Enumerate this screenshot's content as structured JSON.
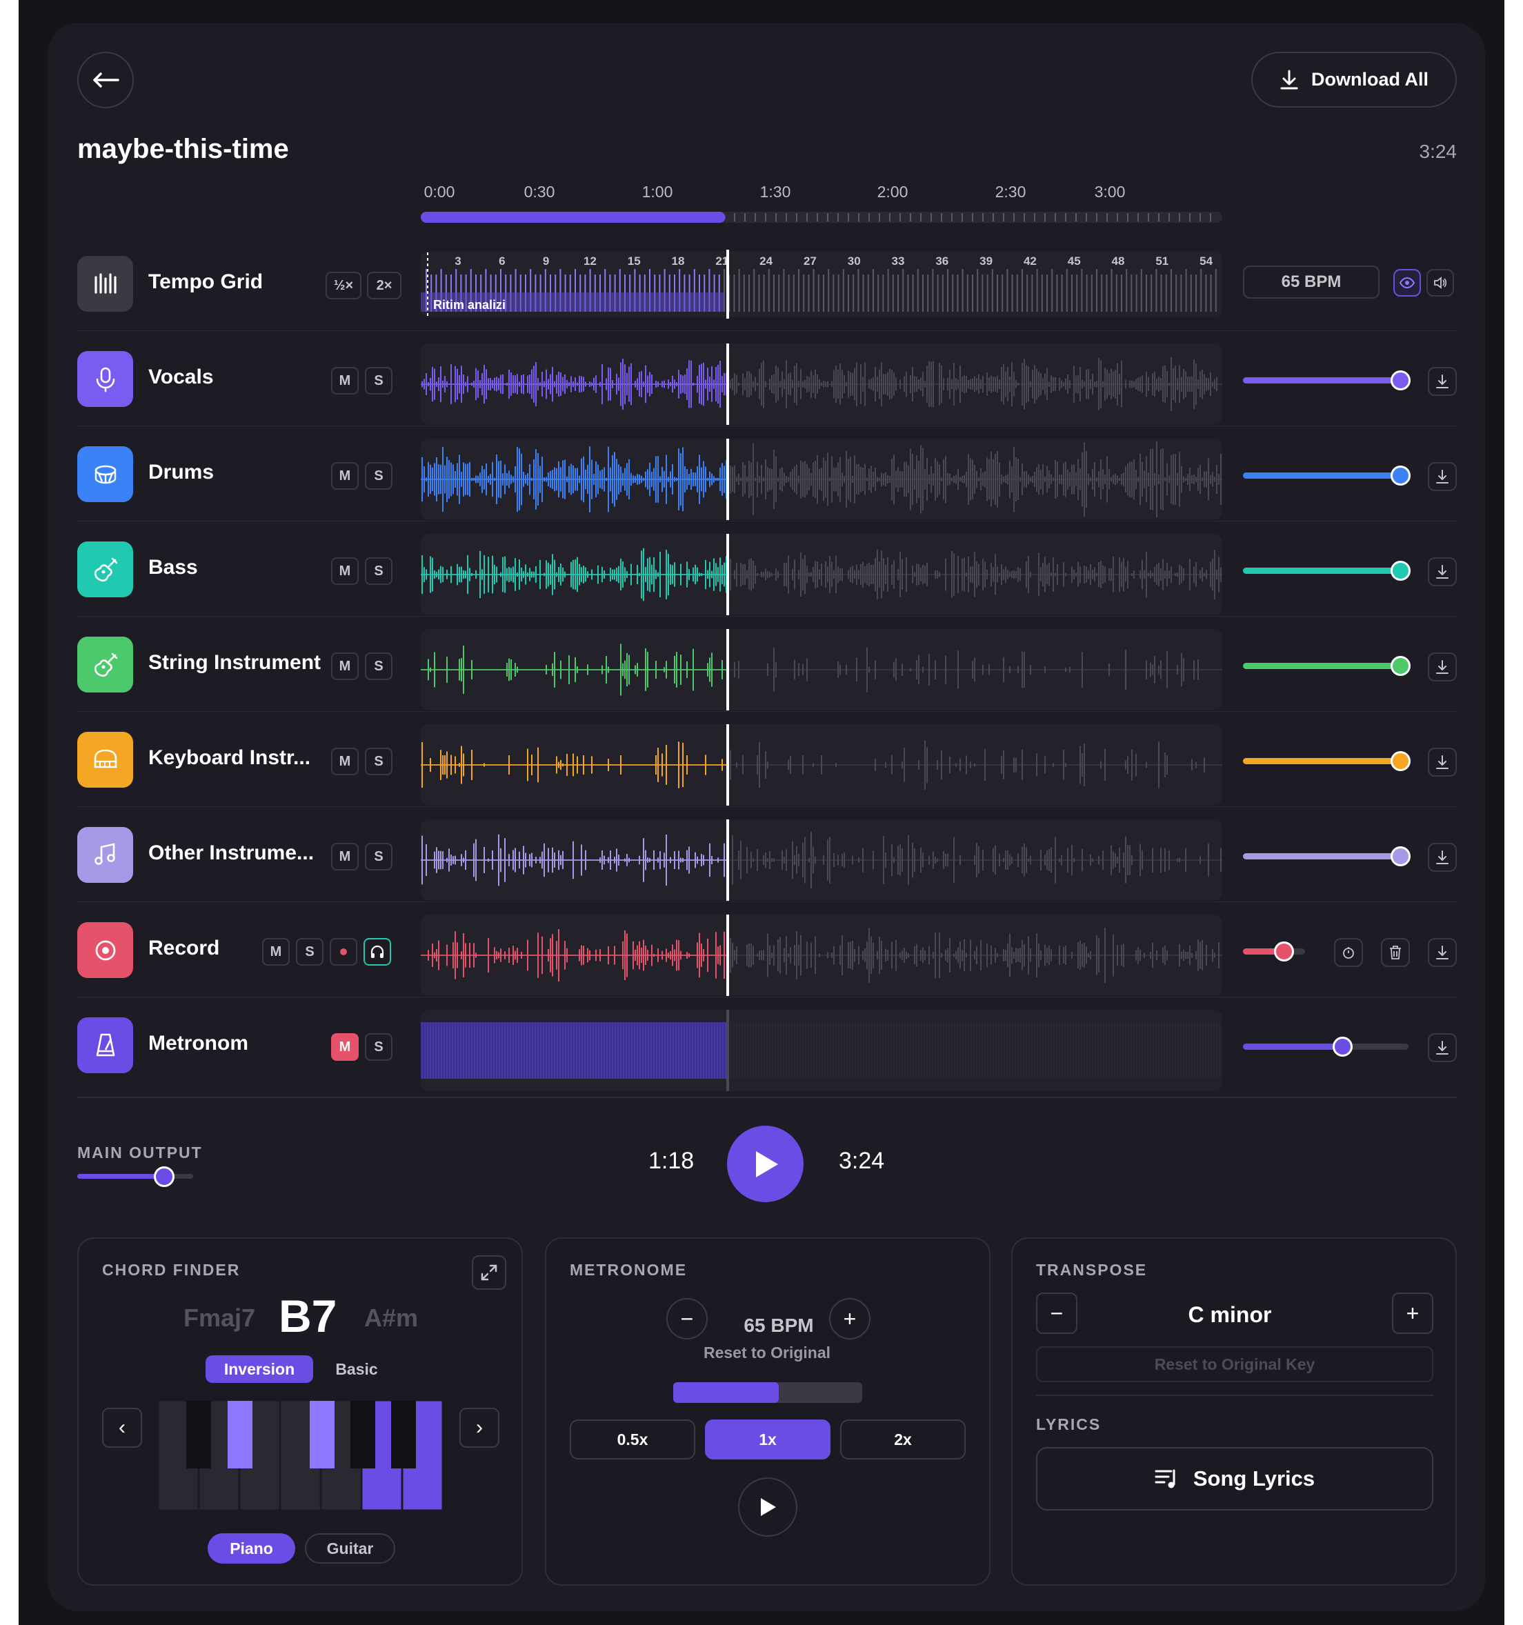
{
  "song": {
    "title": "maybe-this-time",
    "duration": "3:24"
  },
  "header": {
    "download_all": "Download All"
  },
  "timeline": {
    "ticks": [
      "0:00",
      "0:30",
      "1:00",
      "1:30",
      "2:00",
      "2:30",
      "3:00"
    ],
    "progress_fraction": 0.38
  },
  "tempo": {
    "name": "Tempo Grid",
    "half": "½×",
    "double": "2×",
    "bpm_badge": "65 BPM",
    "analysis_label": "Ritim analizi",
    "beats": [
      "3",
      "6",
      "9",
      "12",
      "15",
      "18",
      "21",
      "24",
      "27",
      "30",
      "33",
      "36",
      "39",
      "42",
      "45",
      "48",
      "51",
      "54"
    ]
  },
  "tracks": [
    {
      "name": "Vocals",
      "color": "#7b5cf0",
      "icon": "microphone-icon",
      "volume": 0.95
    },
    {
      "name": "Drums",
      "color": "#3b82f6",
      "icon": "drum-icon",
      "volume": 0.95
    },
    {
      "name": "Bass",
      "color": "#20c9b0",
      "icon": "guitar-icon",
      "volume": 0.95
    },
    {
      "name": "String Instrument",
      "color": "#4cc96a",
      "icon": "guitar-icon",
      "volume": 0.95
    },
    {
      "name": "Keyboard Instr...",
      "color": "#f5a623",
      "icon": "piano-icon",
      "volume": 0.95
    },
    {
      "name": "Other Instrume...",
      "color": "#a59ae6",
      "icon": "music-note-icon",
      "volume": 0.95
    },
    {
      "name": "Record",
      "color": "#e5526a",
      "icon": "record-icon",
      "volume": 0.65
    },
    {
      "name": "Metronom",
      "color": "#6b4de6",
      "icon": "metronome-icon",
      "volume": 0.6
    }
  ],
  "controls": {
    "mute": "M",
    "solo": "S"
  },
  "transport": {
    "main_output_label": "MAIN OUTPUT",
    "main_output_volume": 0.75,
    "current_time": "1:18",
    "total_time": "3:24"
  },
  "chord_finder": {
    "title": "CHORD FINDER",
    "prev_chord": "Fmaj7",
    "current_chord": "B7",
    "next_chord": "A#m",
    "mode_active": "Inversion",
    "mode_other": "Basic",
    "instrument_active": "Piano",
    "instrument_other": "Guitar",
    "prev_arrow": "‹",
    "next_arrow": "›"
  },
  "metronome": {
    "title": "METRONOME",
    "bpm": "65 BPM",
    "reset": "Reset to Original",
    "level": 0.56,
    "speeds": [
      "0.5x",
      "1x",
      "2x"
    ],
    "active_speed": "1x"
  },
  "transpose": {
    "title": "TRANSPOSE",
    "key": "C minor",
    "reset": "Reset to Original Key"
  },
  "lyrics": {
    "title": "LYRICS",
    "button": "Song Lyrics"
  }
}
